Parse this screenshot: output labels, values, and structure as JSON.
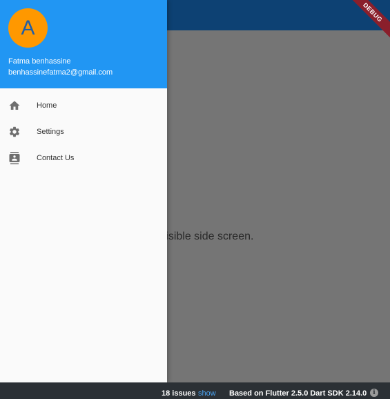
{
  "app": {
    "body_text": "an invisible side screen.",
    "debug_banner": "DEBUG"
  },
  "drawer": {
    "avatar_letter": "A",
    "account_name": "Fatma benhassine",
    "account_email": "benhassinefatma2@gmail.com",
    "items": [
      {
        "label": "Home",
        "icon": "home-icon"
      },
      {
        "label": "Settings",
        "icon": "gear-icon"
      },
      {
        "label": "Contact Us",
        "icon": "contacts-icon"
      }
    ]
  },
  "status_bar": {
    "issues": "18 issues",
    "show_link": "show",
    "sdk": "Based on Flutter 2.5.0 Dart SDK 2.14.0",
    "info_glyph": "i"
  },
  "colors": {
    "app_bar": "#0d4173",
    "drawer_header": "#2196f3",
    "avatar": "#ff9800",
    "scrim": "#757575",
    "status_bar": "#2b3035",
    "link": "#4aa3f0"
  }
}
